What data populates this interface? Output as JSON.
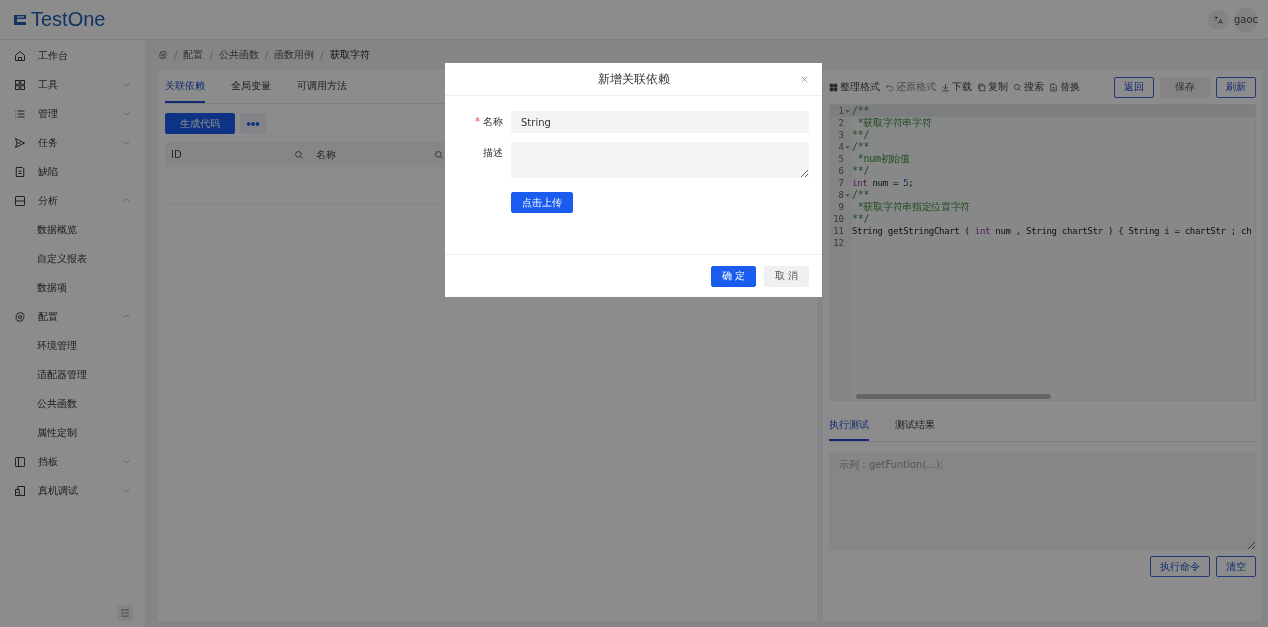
{
  "header": {
    "logo": "TestOne",
    "user": "gaoc"
  },
  "sidebar": {
    "items": [
      {
        "label": "工作台",
        "kind": "link"
      },
      {
        "label": "工具",
        "kind": "group",
        "expanded": false
      },
      {
        "label": "管理",
        "kind": "group",
        "expanded": false
      },
      {
        "label": "任务",
        "kind": "group",
        "expanded": false
      },
      {
        "label": "缺陷",
        "kind": "link"
      },
      {
        "label": "分析",
        "kind": "group",
        "expanded": true,
        "children": [
          {
            "label": "数据概览"
          },
          {
            "label": "自定义报表"
          },
          {
            "label": "数据项"
          }
        ]
      },
      {
        "label": "配置",
        "kind": "group",
        "expanded": true,
        "children": [
          {
            "label": "环境管理"
          },
          {
            "label": "适配器管理"
          },
          {
            "label": "公共函数"
          },
          {
            "label": "属性定制"
          }
        ]
      },
      {
        "label": "挡板",
        "kind": "group",
        "expanded": false
      },
      {
        "label": "真机调试",
        "kind": "group",
        "expanded": false
      }
    ]
  },
  "breadcrumb": {
    "separator": "/",
    "items": [
      "配置",
      "公共函数",
      "函数用例",
      "获取字符"
    ]
  },
  "left_panel": {
    "tabs": [
      {
        "label": "关联依赖",
        "selected": true
      },
      {
        "label": "全局变量",
        "selected": false
      },
      {
        "label": "可调用方法",
        "selected": false
      }
    ],
    "generate_button": "生成代码",
    "table": {
      "columns": [
        "ID",
        "名称"
      ]
    }
  },
  "editor": {
    "toolbar": [
      {
        "label": "整理格式",
        "disabled": false
      },
      {
        "label": "还原格式",
        "disabled": true
      },
      {
        "label": "下载",
        "disabled": false
      },
      {
        "label": "复制",
        "disabled": false
      },
      {
        "label": "搜索",
        "disabled": false
      },
      {
        "label": "替换",
        "disabled": false
      }
    ],
    "buttons": [
      {
        "label": "返回",
        "kind": "outline"
      },
      {
        "label": "保存",
        "kind": "plain"
      },
      {
        "label": "刷新",
        "kind": "outline"
      }
    ],
    "lines": [
      {
        "number": "1",
        "fold": true,
        "tokens": [
          {
            "kind": "comment",
            "text": "/**"
          }
        ]
      },
      {
        "number": "2",
        "fold": false,
        "tokens": [
          {
            "kind": "comment",
            "text": " *获取字符串字符"
          }
        ]
      },
      {
        "number": "3",
        "fold": false,
        "tokens": [
          {
            "kind": "comment",
            "text": "**/"
          }
        ]
      },
      {
        "number": "4",
        "fold": true,
        "tokens": [
          {
            "kind": "comment",
            "text": "/**"
          }
        ]
      },
      {
        "number": "5",
        "fold": false,
        "tokens": [
          {
            "kind": "comment",
            "text": " *num初始值"
          }
        ]
      },
      {
        "number": "6",
        "fold": false,
        "tokens": [
          {
            "kind": "comment",
            "text": "**/"
          }
        ]
      },
      {
        "number": "7",
        "fold": false,
        "tokens": [
          {
            "kind": "keyword",
            "text": "int"
          },
          {
            "kind": "plain",
            "text": " num = "
          },
          {
            "kind": "number",
            "text": "5"
          },
          {
            "kind": "plain",
            "text": ";"
          }
        ]
      },
      {
        "number": "8",
        "fold": true,
        "tokens": [
          {
            "kind": "comment",
            "text": "/**"
          }
        ]
      },
      {
        "number": "9",
        "fold": false,
        "tokens": [
          {
            "kind": "comment",
            "text": " *获取字符串指定位置字符"
          }
        ]
      },
      {
        "number": "10",
        "fold": false,
        "tokens": [
          {
            "kind": "comment",
            "text": "**/"
          }
        ]
      },
      {
        "number": "11",
        "fold": false,
        "tokens": [
          {
            "kind": "plain",
            "text": "String getStringChart ( "
          },
          {
            "kind": "keyword",
            "text": "int"
          },
          {
            "kind": "plain",
            "text": " num , String chartStr ) { String i = chartStr ; ch"
          }
        ]
      },
      {
        "number": "12",
        "fold": false
      }
    ]
  },
  "test_panel": {
    "tabs": [
      {
        "label": "执行测试",
        "selected": true
      },
      {
        "label": "测试结果",
        "selected": false
      }
    ],
    "input": {
      "placeholder": "示列：getFuntion(...);"
    },
    "buttons": [
      "执行命令",
      "清空"
    ]
  },
  "dialog": {
    "title": "新增关联依赖",
    "required_mark": "*",
    "fields": [
      {
        "label": "名称",
        "required": true,
        "kind": "input",
        "value": "String"
      },
      {
        "label": "描述",
        "required": false,
        "kind": "textarea"
      }
    ],
    "upload_button": "点击上传",
    "buttons": [
      {
        "label": "确 定",
        "kind": "primary"
      },
      {
        "label": "取 消",
        "kind": "default"
      }
    ]
  }
}
